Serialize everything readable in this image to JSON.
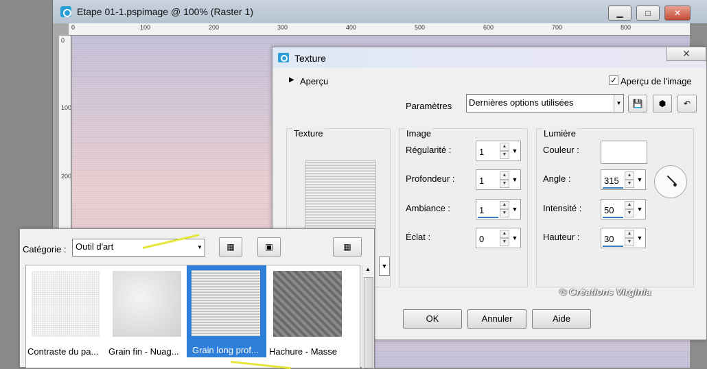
{
  "window": {
    "title": "Etape 01-1.pspimage @ 100% (Raster 1)",
    "minimize": "▁",
    "maximize": "□",
    "close": "✕"
  },
  "ruler": {
    "h_labels": [
      "0",
      "100",
      "200",
      "300",
      "400",
      "500",
      "600",
      "700",
      "800"
    ],
    "v_labels": [
      "0",
      "100",
      "200"
    ]
  },
  "dialog": {
    "title": "Texture",
    "close_label": "✕",
    "apercu": "Aperçu",
    "apercu_image": "Aperçu de l'image",
    "apercu_checked": true,
    "parametres_label": "Paramètres",
    "parametres_value": "Dernières options utilisées",
    "texture_group": "Texture",
    "image_group": "Image",
    "lumiere_group": "Lumière",
    "image_fields": [
      {
        "label": "Régularité :",
        "value": "1"
      },
      {
        "label": "Profondeur :",
        "value": "1"
      },
      {
        "label": "Ambiance :",
        "value": "1"
      },
      {
        "label": "Éclat :",
        "value": "0"
      }
    ],
    "lumiere_fields": [
      {
        "label": "Couleur :"
      },
      {
        "label": "Angle :",
        "value": "315"
      },
      {
        "label": "Intensité :",
        "value": "50"
      },
      {
        "label": "Hauteur :",
        "value": "30"
      }
    ],
    "ok": "OK",
    "annuler": "Annuler",
    "aide": "Aide"
  },
  "watermark": "© Créations Virginia",
  "picker": {
    "categorie_label": "Catégorie :",
    "categorie_value": "Outil d'art",
    "tiles": [
      {
        "caption": "Contraste du pa..."
      },
      {
        "caption": "Grain fin - Nuag..."
      },
      {
        "caption": "Grain long prof...",
        "selected": true
      },
      {
        "caption": "Hachure - Masse"
      }
    ]
  },
  "colors": {
    "accent": "#2e7fd9",
    "arrow": "#e4e63a",
    "close": "#c44a35"
  }
}
